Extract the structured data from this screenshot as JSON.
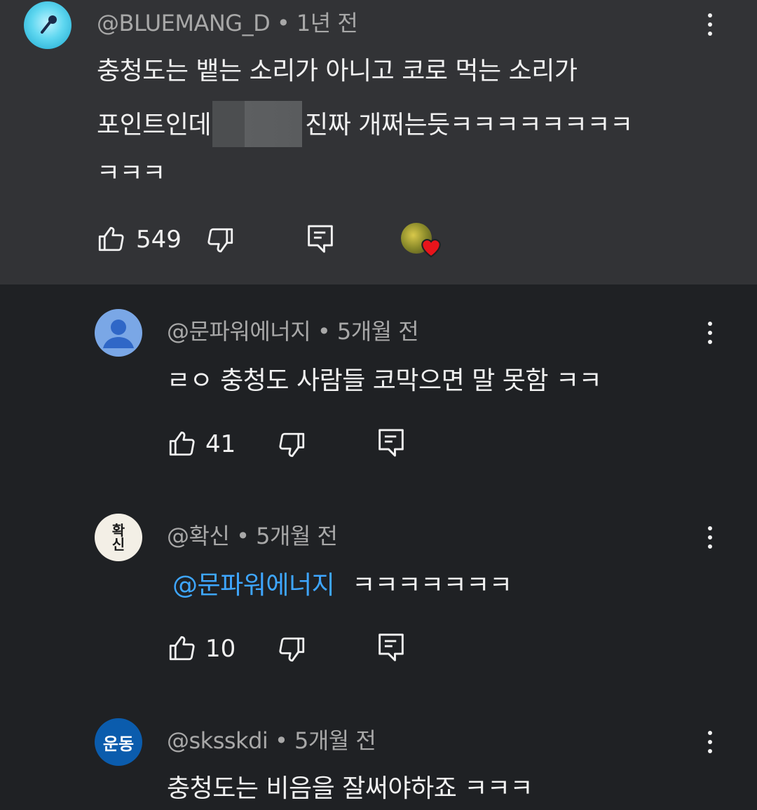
{
  "comments": [
    {
      "handle": "@BLUEMANG_D",
      "time": "• 1년 전",
      "line1": "충청도는 뱉는 소리가 아니고 코로 먹는 소리가",
      "line2_a": "포인트인데",
      "line2_b": "진짜 개쩌는듯ㅋㅋㅋㅋㅋㅋㅋㅋ",
      "line3": "ㅋㅋㅋ",
      "likes": "549",
      "avatar_icon": "microphone-icon",
      "creator_heart": true
    },
    {
      "handle": "@문파워에너지",
      "time": "• 5개월 전",
      "text": "ㄹㅇ 충청도 사람들 코막으면 말 못함 ㅋㅋ",
      "likes": "41",
      "avatar_icon": "default-person-icon"
    },
    {
      "handle": "@확신",
      "time": "• 5개월 전",
      "mention": "@문파워에너지",
      "text": "ㅋㅋㅋㅋㅋㅋㅋ",
      "likes": "10",
      "avatar_text": "확신"
    },
    {
      "handle": "@sksskdi",
      "time": "• 5개월 전",
      "text": "충청도는 비음을 잘써야하죠 ㅋㅋㅋ",
      "avatar_text": "운동"
    }
  ],
  "colors": {
    "background": "#1f2124",
    "highlight_background": "#323336",
    "meta_text": "#a8a8a8",
    "mention": "#3ea6ff",
    "heart": "#e8141b"
  }
}
